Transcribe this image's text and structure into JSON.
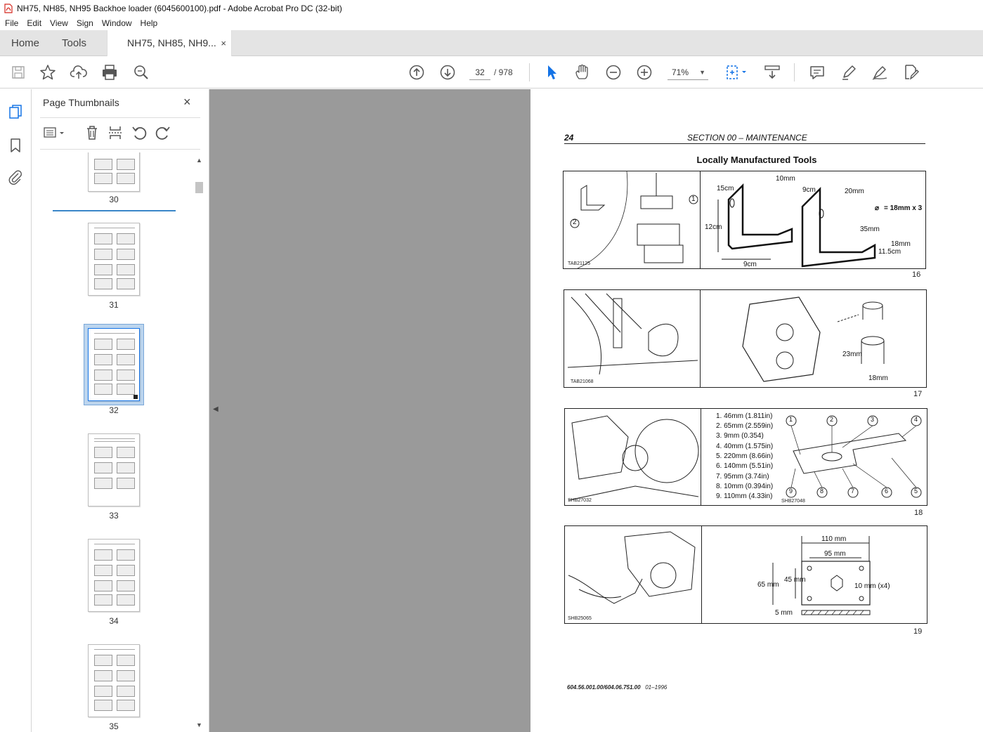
{
  "window": {
    "title": "NH75, NH85, NH95 Backhoe loader (6045600100).pdf - Adobe Acrobat Pro DC (32-bit)"
  },
  "menu": [
    "File",
    "Edit",
    "View",
    "Sign",
    "Window",
    "Help"
  ],
  "tabs": {
    "home": "Home",
    "tools": "Tools",
    "document": "NH75, NH85, NH9...",
    "close": "×"
  },
  "toolbar": {
    "current_page": "32",
    "page_total": "/ 978",
    "zoom": "71%"
  },
  "thumbnail_panel": {
    "title": "Page Thumbnails",
    "close": "×",
    "pages": [
      "30",
      "31",
      "32",
      "33",
      "34",
      "35"
    ],
    "selected_page": "32"
  },
  "document_page": {
    "page_number": "24",
    "section": "SECTION 00 – MAINTENANCE",
    "heading": "Locally Manufactured Tools",
    "figures": [
      {
        "number": "16",
        "code": "TAB21125",
        "dims": [
          "10mm",
          "15cm",
          "9cm",
          "20mm",
          "= 18mm x 3",
          "12cm",
          "35mm",
          "18mm",
          "11.5cm",
          "9cm"
        ],
        "callouts": [
          "1",
          "2"
        ]
      },
      {
        "number": "17",
        "code": "TAB21068",
        "dims": [
          "23mm",
          "18mm"
        ]
      },
      {
        "number": "18",
        "code": "SHB27032",
        "code2": "SHB27048",
        "specs": [
          "1.   46mm (1.811in)",
          "2.   65mm (2.559in)",
          "3.   9mm  (0.354)",
          "4.   40mm (1.575in)",
          "5.   220mm (8.66in)",
          "6.   140mm (5.51in)",
          "7.   95mm  (3.74in)",
          "8.   10mm  (0.394in)",
          "9.   110mm (4.33in)"
        ],
        "callouts": [
          "1",
          "2",
          "3",
          "4",
          "5",
          "6",
          "7",
          "8",
          "9"
        ]
      },
      {
        "number": "19",
        "code": "SHB25065",
        "dims": [
          "110 mm",
          "95 mm",
          "65 mm",
          "45 mm",
          "10 mm (x4)",
          "5 mm"
        ]
      }
    ],
    "footer_code": "604.56.001.00/604.06.751.00",
    "footer_date": "01–1996"
  },
  "colors": {
    "accent": "#1473e6",
    "viewer_bg": "#9a9a9a",
    "tabbar_bg": "#e4e4e4",
    "acrobat_red": "#d4281f"
  }
}
